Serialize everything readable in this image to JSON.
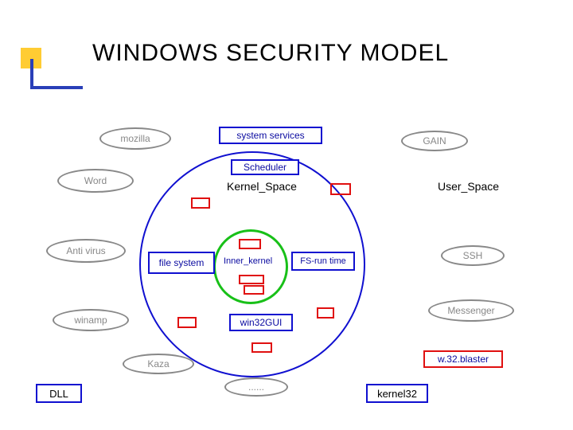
{
  "title": "WINDOWS SECURITY MODEL",
  "labels": {
    "kernel_space": "Kernel_Space",
    "user_space": "User_Space",
    "inner_kernel": "Inner_kernel"
  },
  "rect_boxes": {
    "system_services": "system services",
    "scheduler": "Scheduler",
    "file_system": "file system",
    "fs_runtime": "FS-run time",
    "win32gui": "win32GUI",
    "dll": "DLL",
    "kernel32": "kernel32",
    "w32_blaster": "w.32.blaster"
  },
  "ellipse_boxes": {
    "mozilla": "mozilla",
    "word": "Word",
    "antivirus": "Anti virus",
    "winamp": "winamp",
    "kaza": "Kaza",
    "gain": "GAIN",
    "ssh": "SSH",
    "messenger": "Messenger",
    "dots": "......"
  },
  "colors": {
    "accent_yellow": "#ffcc33",
    "accent_blue": "#2a3fb8",
    "box_blue": "#1010d0",
    "box_red": "#e01010",
    "inner_green": "#18c018",
    "ellipse_gray": "#888888"
  }
}
